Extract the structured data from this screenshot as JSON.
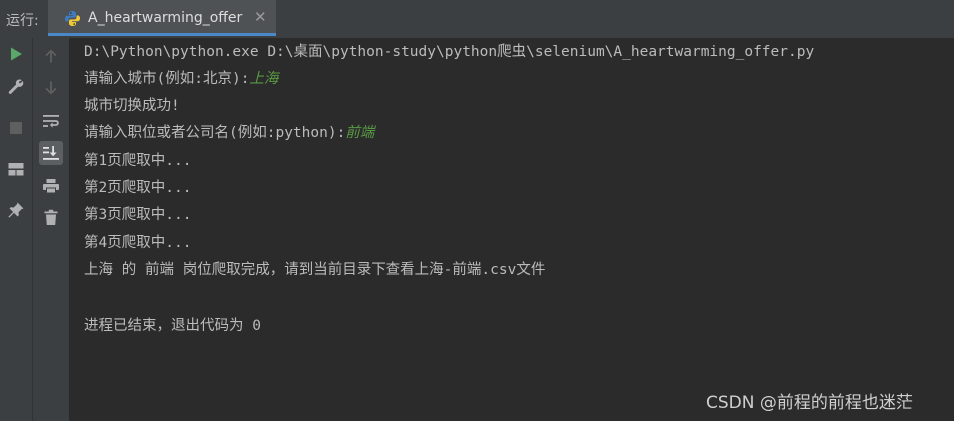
{
  "header": {
    "run_label": "运行:",
    "tab_title": "A_heartwarming_offer",
    "tab_close": "✕"
  },
  "toolbar_left": {
    "items": [
      "run-icon",
      "wrench-icon",
      "stop-icon",
      "layout-icon",
      "pin-icon"
    ]
  },
  "toolbar_right": {
    "items": [
      "arrow-up-icon",
      "arrow-down-icon",
      "soft-wrap-icon",
      "scroll-to-end-icon",
      "print-icon",
      "trash-icon"
    ]
  },
  "console": {
    "command": "D:\\Python\\python.exe D:\\桌面\\python-study\\python爬虫\\selenium\\A_heartwarming_offer.py",
    "prompt_city": "请输入城市(例如:北京):",
    "input_city": "上海",
    "city_switched": "城市切换成功!",
    "prompt_job": "请输入职位或者公司名(例如:python):",
    "input_job": "前端",
    "page1": "第1页爬取中...",
    "page2": "第2页爬取中...",
    "page3": "第3页爬取中...",
    "page4": "第4页爬取中...",
    "done": "上海 的 前端 岗位爬取完成，请到当前目录下查看上海-前端.csv文件",
    "exit": "进程已结束，退出代码为 0"
  },
  "watermark": "CSDN @前程的前程也迷茫",
  "colors": {
    "background": "#2b2b2b",
    "panel": "#3c3f41",
    "text": "#bbbbbb",
    "user_input": "#5a9a44",
    "run_green": "#59a869",
    "tab_accent": "#4a88c7"
  }
}
